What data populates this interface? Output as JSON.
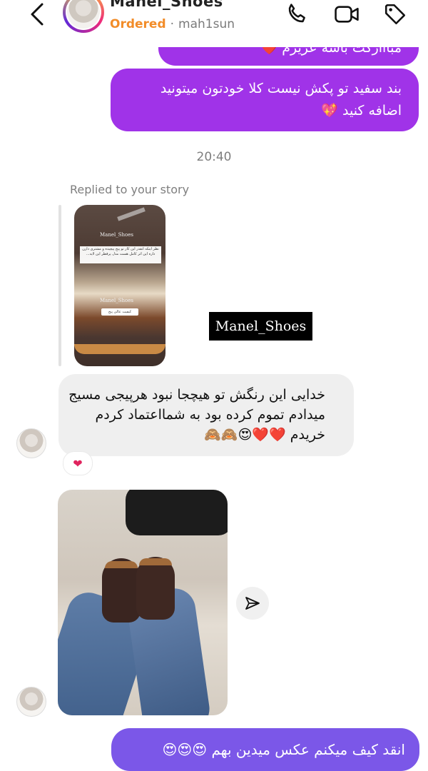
{
  "header": {
    "title": "Manel_Shoes",
    "status_label": "Ordered",
    "separator": "·",
    "username": "mah1sun"
  },
  "messages": {
    "out_top_partial": "مبااارکت باشه عزیزم ❤️",
    "out_second": "بند سفید تو پکش نیست کلا خودتون میتونید اضافه کنید 💖",
    "timestamp": "20:40",
    "reply_label": "Replied to your story",
    "story": {
      "brand_text": "Manel_Shoes",
      "overlay_text": "نظر اینکه انقدر این کار تو پیج پیچیده و مشتری دارن داره این اثر کامل هست مدل پرقطر این لایه...",
      "small_label": "کیفیت عالی پیج"
    },
    "story_caption": "Manel_Shoes",
    "in_message": "خدایی این رنگش تو هیچجا نبود هرپیجی مسیج میدادم تموم کرده بود به شمااعتماد کردم خریدم ❤️❤️😍🙈🙈",
    "in_reaction": "❤",
    "out_last": "انقد کیف میکنم عکس میدین بهم 😍😍😍"
  },
  "colors": {
    "outgoing": "#a033e8",
    "outgoing_last": "#7b57e8",
    "incoming": "#efefef",
    "ordered": "#f28c28"
  }
}
